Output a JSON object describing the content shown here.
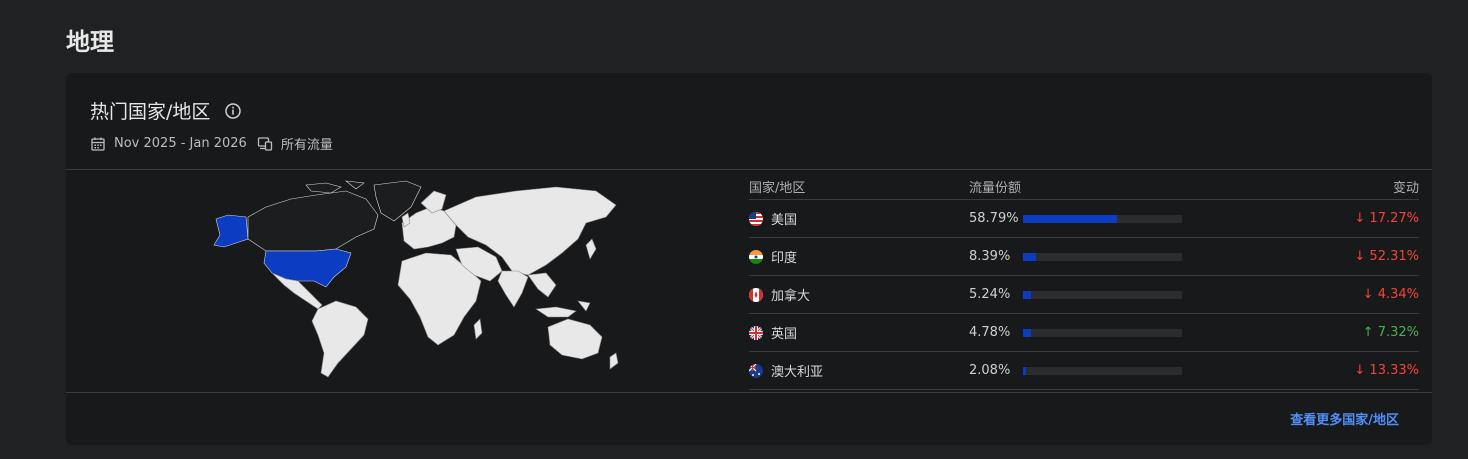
{
  "section": {
    "title": "地理"
  },
  "card": {
    "title": "热门国家/地区",
    "date_range": "Nov 2025 - Jan 2026",
    "traffic_filter": "所有流量",
    "icons": {
      "info": "info-icon",
      "calendar": "calendar-icon",
      "traffic": "devices-icon"
    }
  },
  "table": {
    "headers": {
      "country": "国家/地区",
      "share": "流量份额",
      "change": "变动"
    },
    "rows": [
      {
        "country": "美国",
        "flag": "us-flag-icon",
        "share_text": "58.79%",
        "share": 58.79,
        "change": "17.27%",
        "direction": "down",
        "arrow": "↓"
      },
      {
        "country": "印度",
        "flag": "in-flag-icon",
        "share_text": "8.39%",
        "share": 8.39,
        "change": "52.31%",
        "direction": "down",
        "arrow": "↓"
      },
      {
        "country": "加拿大",
        "flag": "ca-flag-icon",
        "share_text": "5.24%",
        "share": 5.24,
        "change": "4.34%",
        "direction": "down",
        "arrow": "↓"
      },
      {
        "country": "英国",
        "flag": "gb-flag-icon",
        "share_text": "4.78%",
        "share": 4.78,
        "change": "7.32%",
        "direction": "up",
        "arrow": "↑"
      },
      {
        "country": "澳大利亚",
        "flag": "au-flag-icon",
        "share_text": "2.08%",
        "share": 2.08,
        "change": "13.33%",
        "direction": "down",
        "arrow": "↓"
      }
    ]
  },
  "map": {
    "highlight_color": "#0b3cc1",
    "land_color": "#e8e8e8",
    "highlighted": [
      "美国"
    ]
  },
  "footer": {
    "link": "查看更多国家/地区"
  },
  "colors": {
    "bar": "#0b3cc1",
    "down": "#f44336",
    "up": "#4caf50",
    "link": "#4f8ff7"
  }
}
